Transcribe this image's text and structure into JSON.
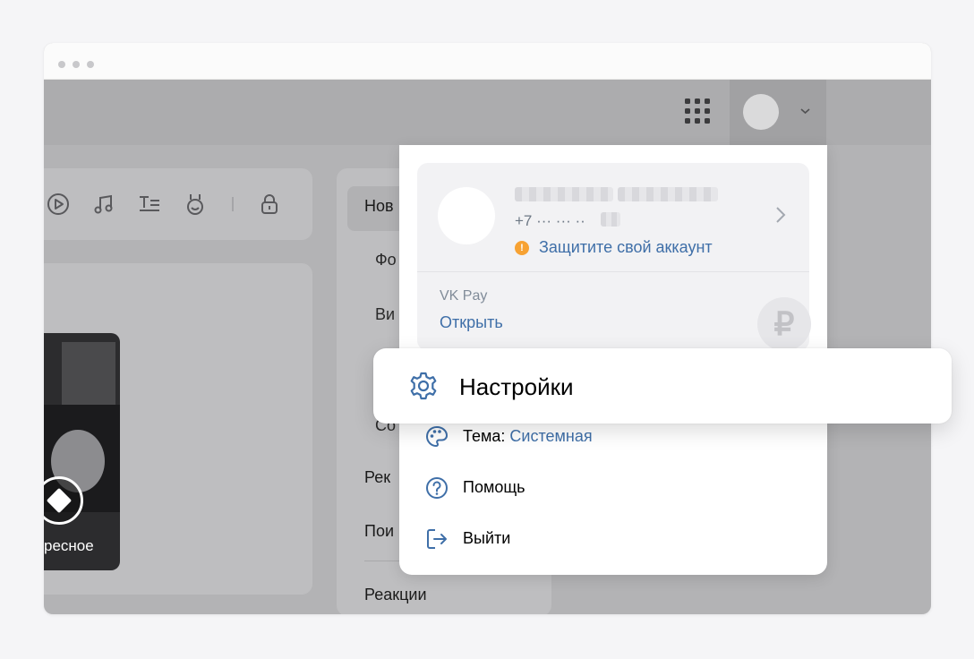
{
  "topbar": {
    "apps_icon": "grid-icon",
    "avatar_icon": "avatar",
    "dropdown_icon": "chevron-down-icon"
  },
  "composer": {
    "icons": [
      "video-play-icon",
      "music-icon",
      "text-format-icon",
      "emoji-icon",
      "lock-icon"
    ]
  },
  "stories": {
    "card_label": "ресное"
  },
  "right_menu": {
    "items": [
      {
        "label": "Нов"
      },
      {
        "label": "Фо"
      },
      {
        "label": "Ви"
      },
      {
        "label": "Со"
      },
      {
        "label": "Рек"
      },
      {
        "label": "Пои"
      },
      {
        "label": "Реакции"
      }
    ]
  },
  "profile_menu": {
    "account": {
      "phone_prefix": "+7 ··· ··· ··",
      "warning_icon_text": "!",
      "warning_text": "Защитите свой аккаунт"
    },
    "vkpay": {
      "label": "VK Pay",
      "action": "Открыть",
      "currency_symbol": "₽"
    },
    "settings": {
      "label": "Настройки"
    },
    "theme": {
      "label": "Тема:",
      "value": "Системная"
    },
    "help": {
      "label": "Помощь"
    },
    "logout": {
      "label": "Выйти"
    }
  },
  "colors": {
    "link": "#3f6fa8",
    "warning": "#f7a233",
    "overlay": "#b3b3b5",
    "icon_blue": "#3f6fa8"
  }
}
